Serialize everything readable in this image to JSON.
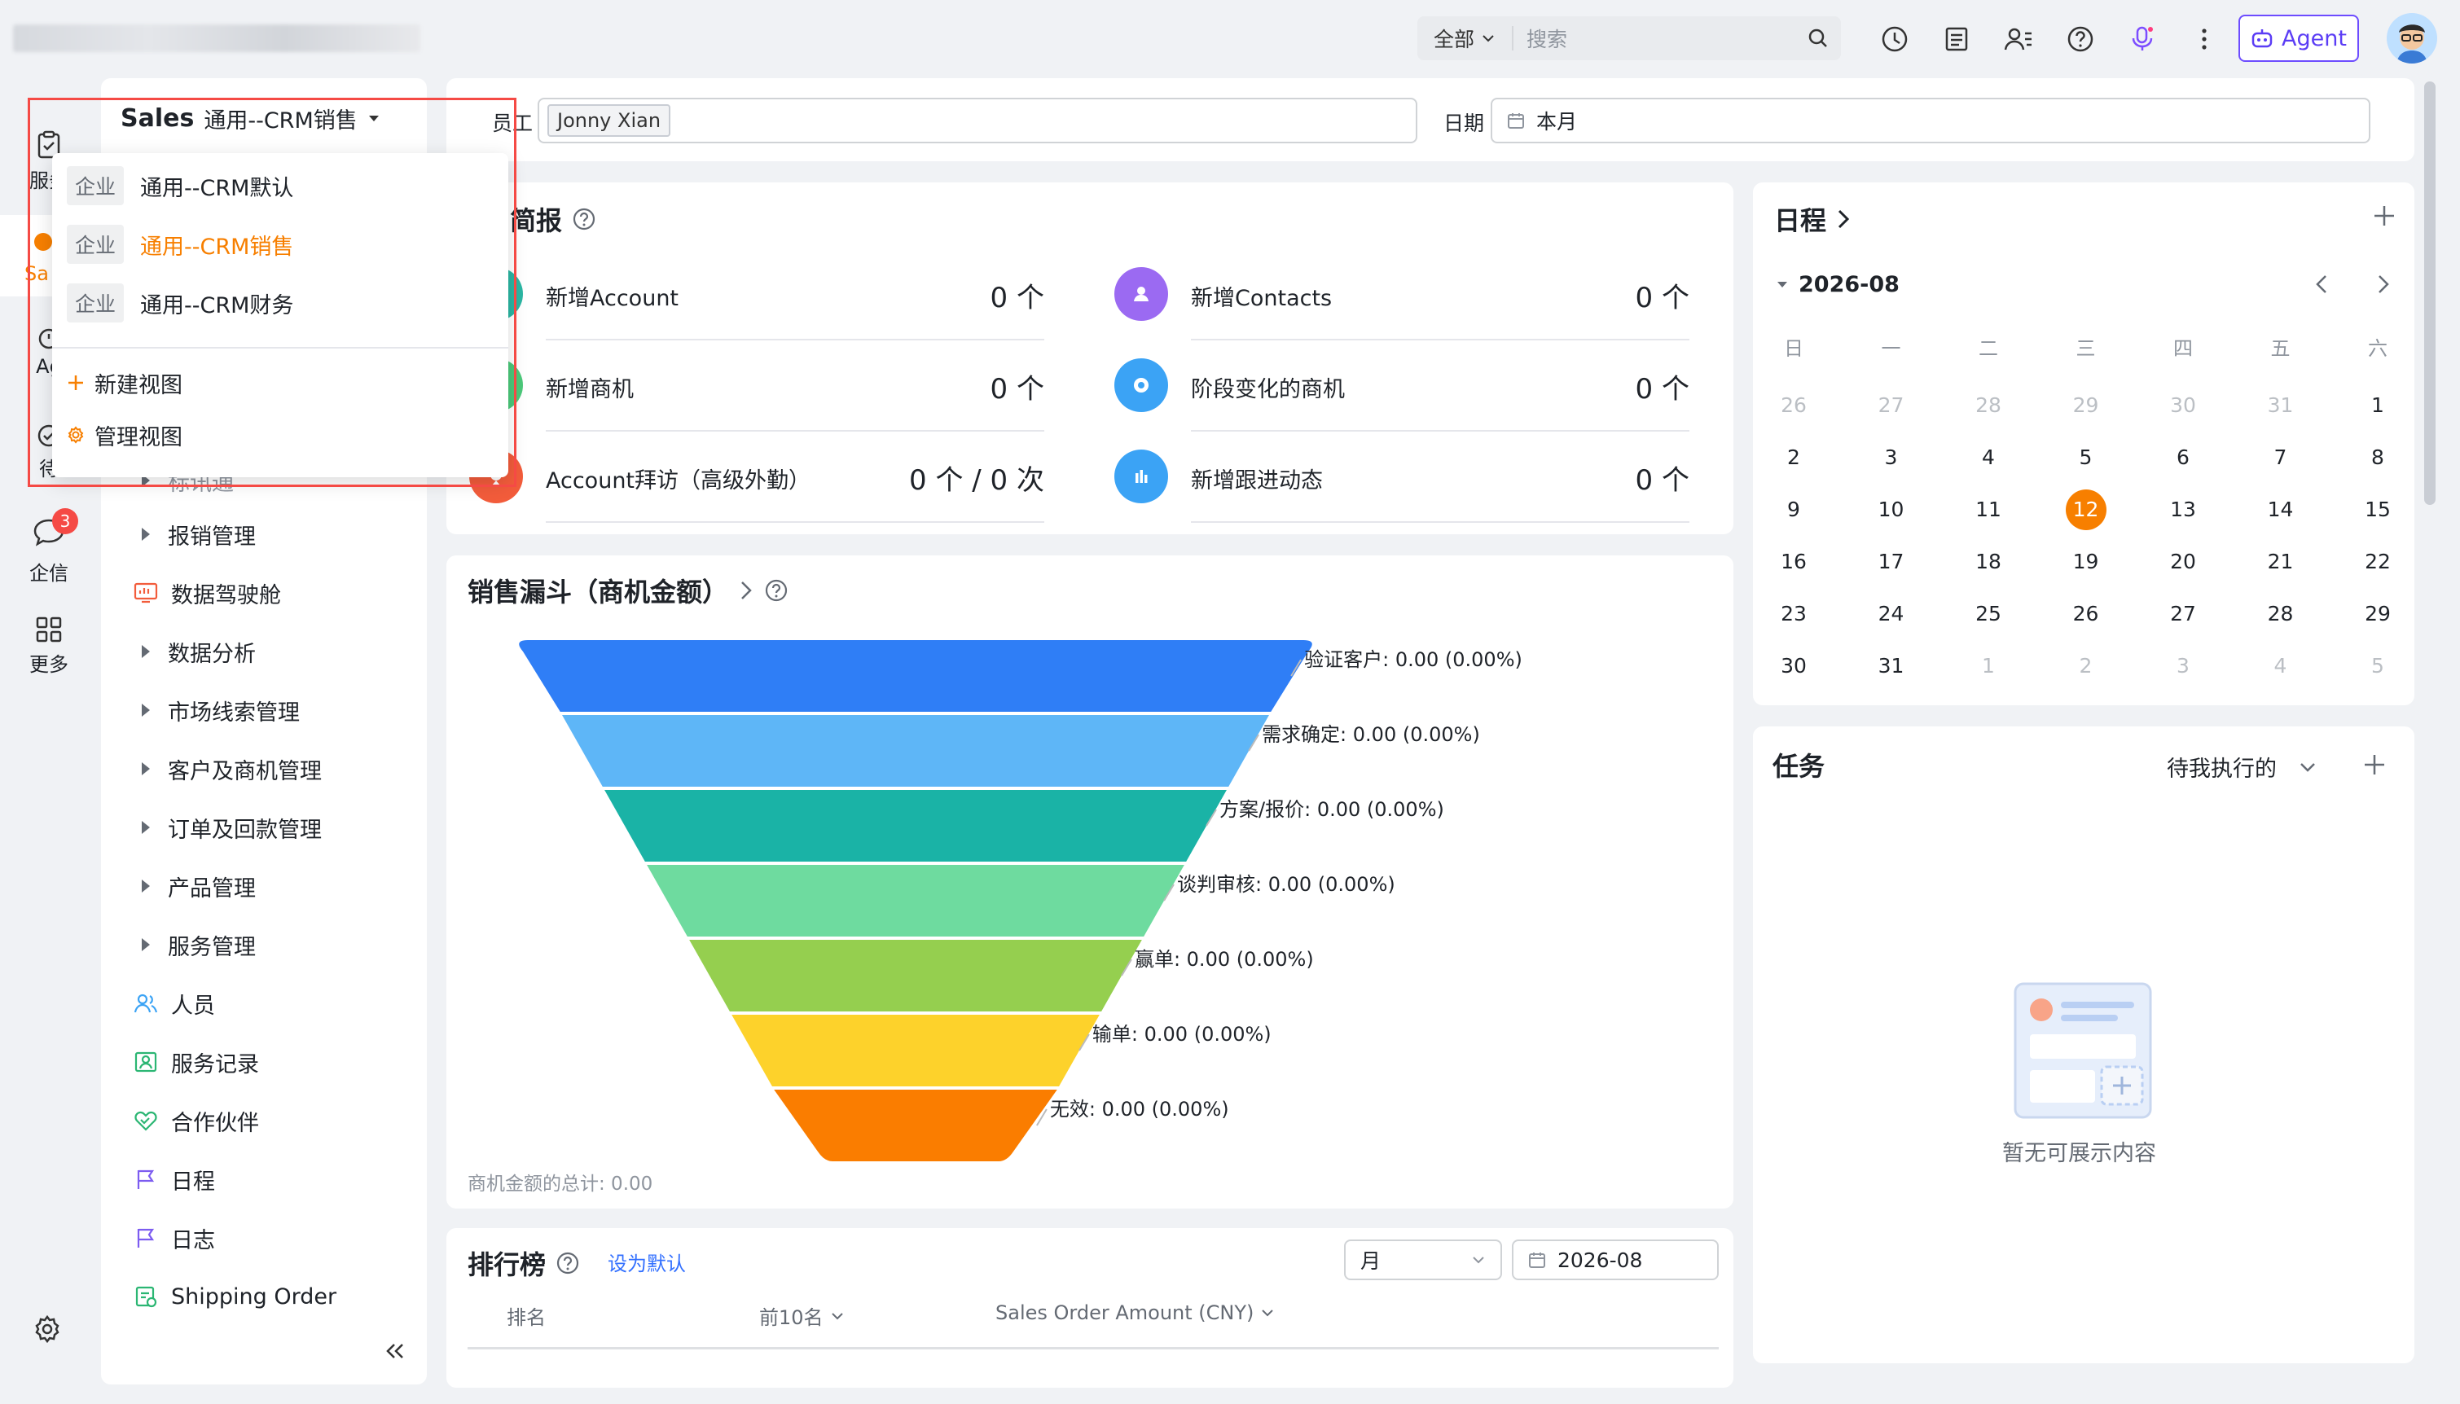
{
  "topbar": {
    "search_scope": "全部",
    "search_placeholder": "搜索",
    "agent_label": "Agent"
  },
  "rail": {
    "items": [
      {
        "label": "服务"
      },
      {
        "label": "Sa"
      },
      {
        "label": "Ag"
      },
      {
        "label": "待"
      },
      {
        "label": "企信",
        "badge": "3"
      },
      {
        "label": "更多"
      }
    ]
  },
  "nav": {
    "app_name": "Sales",
    "view_name": "通用--CRM销售",
    "items": [
      {
        "label": "报销管理",
        "type": "folder"
      },
      {
        "label": "数据驾驶舱",
        "type": "link"
      },
      {
        "label": "数据分析",
        "type": "folder"
      },
      {
        "label": "市场线索管理",
        "type": "folder"
      },
      {
        "label": "客户及商机管理",
        "type": "folder"
      },
      {
        "label": "订单及回款管理",
        "type": "folder"
      },
      {
        "label": "产品管理",
        "type": "folder"
      },
      {
        "label": "服务管理",
        "type": "folder"
      },
      {
        "label": "人员",
        "type": "link"
      },
      {
        "label": "服务记录",
        "type": "link"
      },
      {
        "label": "合作伙伴",
        "type": "link"
      },
      {
        "label": "日程",
        "type": "link"
      },
      {
        "label": "日志",
        "type": "link"
      },
      {
        "label": "Shipping Order",
        "type": "link"
      }
    ],
    "partial_item": "标讯通"
  },
  "dropdown": {
    "views": [
      {
        "tag": "企业",
        "label": "通用--CRM默认",
        "selected": false
      },
      {
        "tag": "企业",
        "label": "通用--CRM销售",
        "selected": true
      },
      {
        "tag": "企业",
        "label": "通用--CRM财务",
        "selected": false
      }
    ],
    "new_view": "新建视图",
    "manage_view": "管理视图"
  },
  "filters": {
    "employee_label": "员工",
    "employee_value": "Jonny Xian",
    "date_label": "日期",
    "date_value": "本月"
  },
  "briefing": {
    "title": "售简报",
    "stats": [
      {
        "label": "新增Account",
        "value": "0 个",
        "color": "#2bb6a3"
      },
      {
        "label": "新增Contacts",
        "value": "0 个",
        "color": "#9b6af2"
      },
      {
        "label": "新增商机",
        "value": "0 个",
        "color": "#4cc97a"
      },
      {
        "label": "阶段变化的商机",
        "value": "0 个",
        "color": "#3ba3f5"
      },
      {
        "label": "Account拜访（高级外勤）",
        "value": "0 个 / 0 次",
        "color": "#f25c3b"
      },
      {
        "label": "新增跟进动态",
        "value": "0 个",
        "color": "#3ba3f5"
      }
    ]
  },
  "funnel": {
    "title": "销售漏斗（商机金额）",
    "total_text": "商机金额的总计: 0.00",
    "stages": [
      {
        "label": "验证客户: 0.00 (0.00%)",
        "color": "#2f7ef6"
      },
      {
        "label": "需求确定: 0.00 (0.00%)",
        "color": "#5eb6f7"
      },
      {
        "label": "方案/报价: 0.00 (0.00%)",
        "color": "#1ab3a6"
      },
      {
        "label": "谈判审核: 0.00 (0.00%)",
        "color": "#6edb9f"
      },
      {
        "label": "赢单: 0.00 (0.00%)",
        "color": "#95cf4f"
      },
      {
        "label": "输单: 0.00 (0.00%)",
        "color": "#fdd22b"
      },
      {
        "label": "无效: 0.00 (0.00%)",
        "color": "#fa7d00"
      }
    ]
  },
  "ranking": {
    "title": "排行榜",
    "set_default": "设为默认",
    "period": "月",
    "date": "2026-08",
    "columns": [
      "排名",
      "前10名",
      "Sales Order Amount (CNY)"
    ]
  },
  "calendar": {
    "title": "日程",
    "month": "2026-08",
    "weekdays": [
      "日",
      "一",
      "二",
      "三",
      "四",
      "五",
      "六"
    ],
    "weeks": [
      [
        [
          "26",
          1
        ],
        [
          "27",
          1
        ],
        [
          "28",
          1
        ],
        [
          "29",
          1
        ],
        [
          "30",
          1
        ],
        [
          "31",
          1
        ],
        [
          "1",
          0
        ]
      ],
      [
        [
          "2",
          0
        ],
        [
          "3",
          0
        ],
        [
          "4",
          0
        ],
        [
          "5",
          0
        ],
        [
          "6",
          0
        ],
        [
          "7",
          0
        ],
        [
          "8",
          0
        ]
      ],
      [
        [
          "9",
          0
        ],
        [
          "10",
          0
        ],
        [
          "11",
          0
        ],
        [
          "12",
          2
        ],
        [
          "13",
          0
        ],
        [
          "14",
          0
        ],
        [
          "15",
          0
        ]
      ],
      [
        [
          "16",
          0
        ],
        [
          "17",
          0
        ],
        [
          "18",
          0
        ],
        [
          "19",
          0
        ],
        [
          "20",
          0
        ],
        [
          "21",
          0
        ],
        [
          "22",
          0
        ]
      ],
      [
        [
          "23",
          0
        ],
        [
          "24",
          0
        ],
        [
          "25",
          0
        ],
        [
          "26",
          0
        ],
        [
          "27",
          0
        ],
        [
          "28",
          0
        ],
        [
          "29",
          0
        ]
      ],
      [
        [
          "30",
          0
        ],
        [
          "31",
          0
        ],
        [
          "1",
          1
        ],
        [
          "2",
          1
        ],
        [
          "3",
          1
        ],
        [
          "4",
          1
        ],
        [
          "5",
          1
        ]
      ]
    ]
  },
  "tasks": {
    "title": "任务",
    "filter": "待我执行的",
    "empty_text": "暂无可展示内容"
  }
}
